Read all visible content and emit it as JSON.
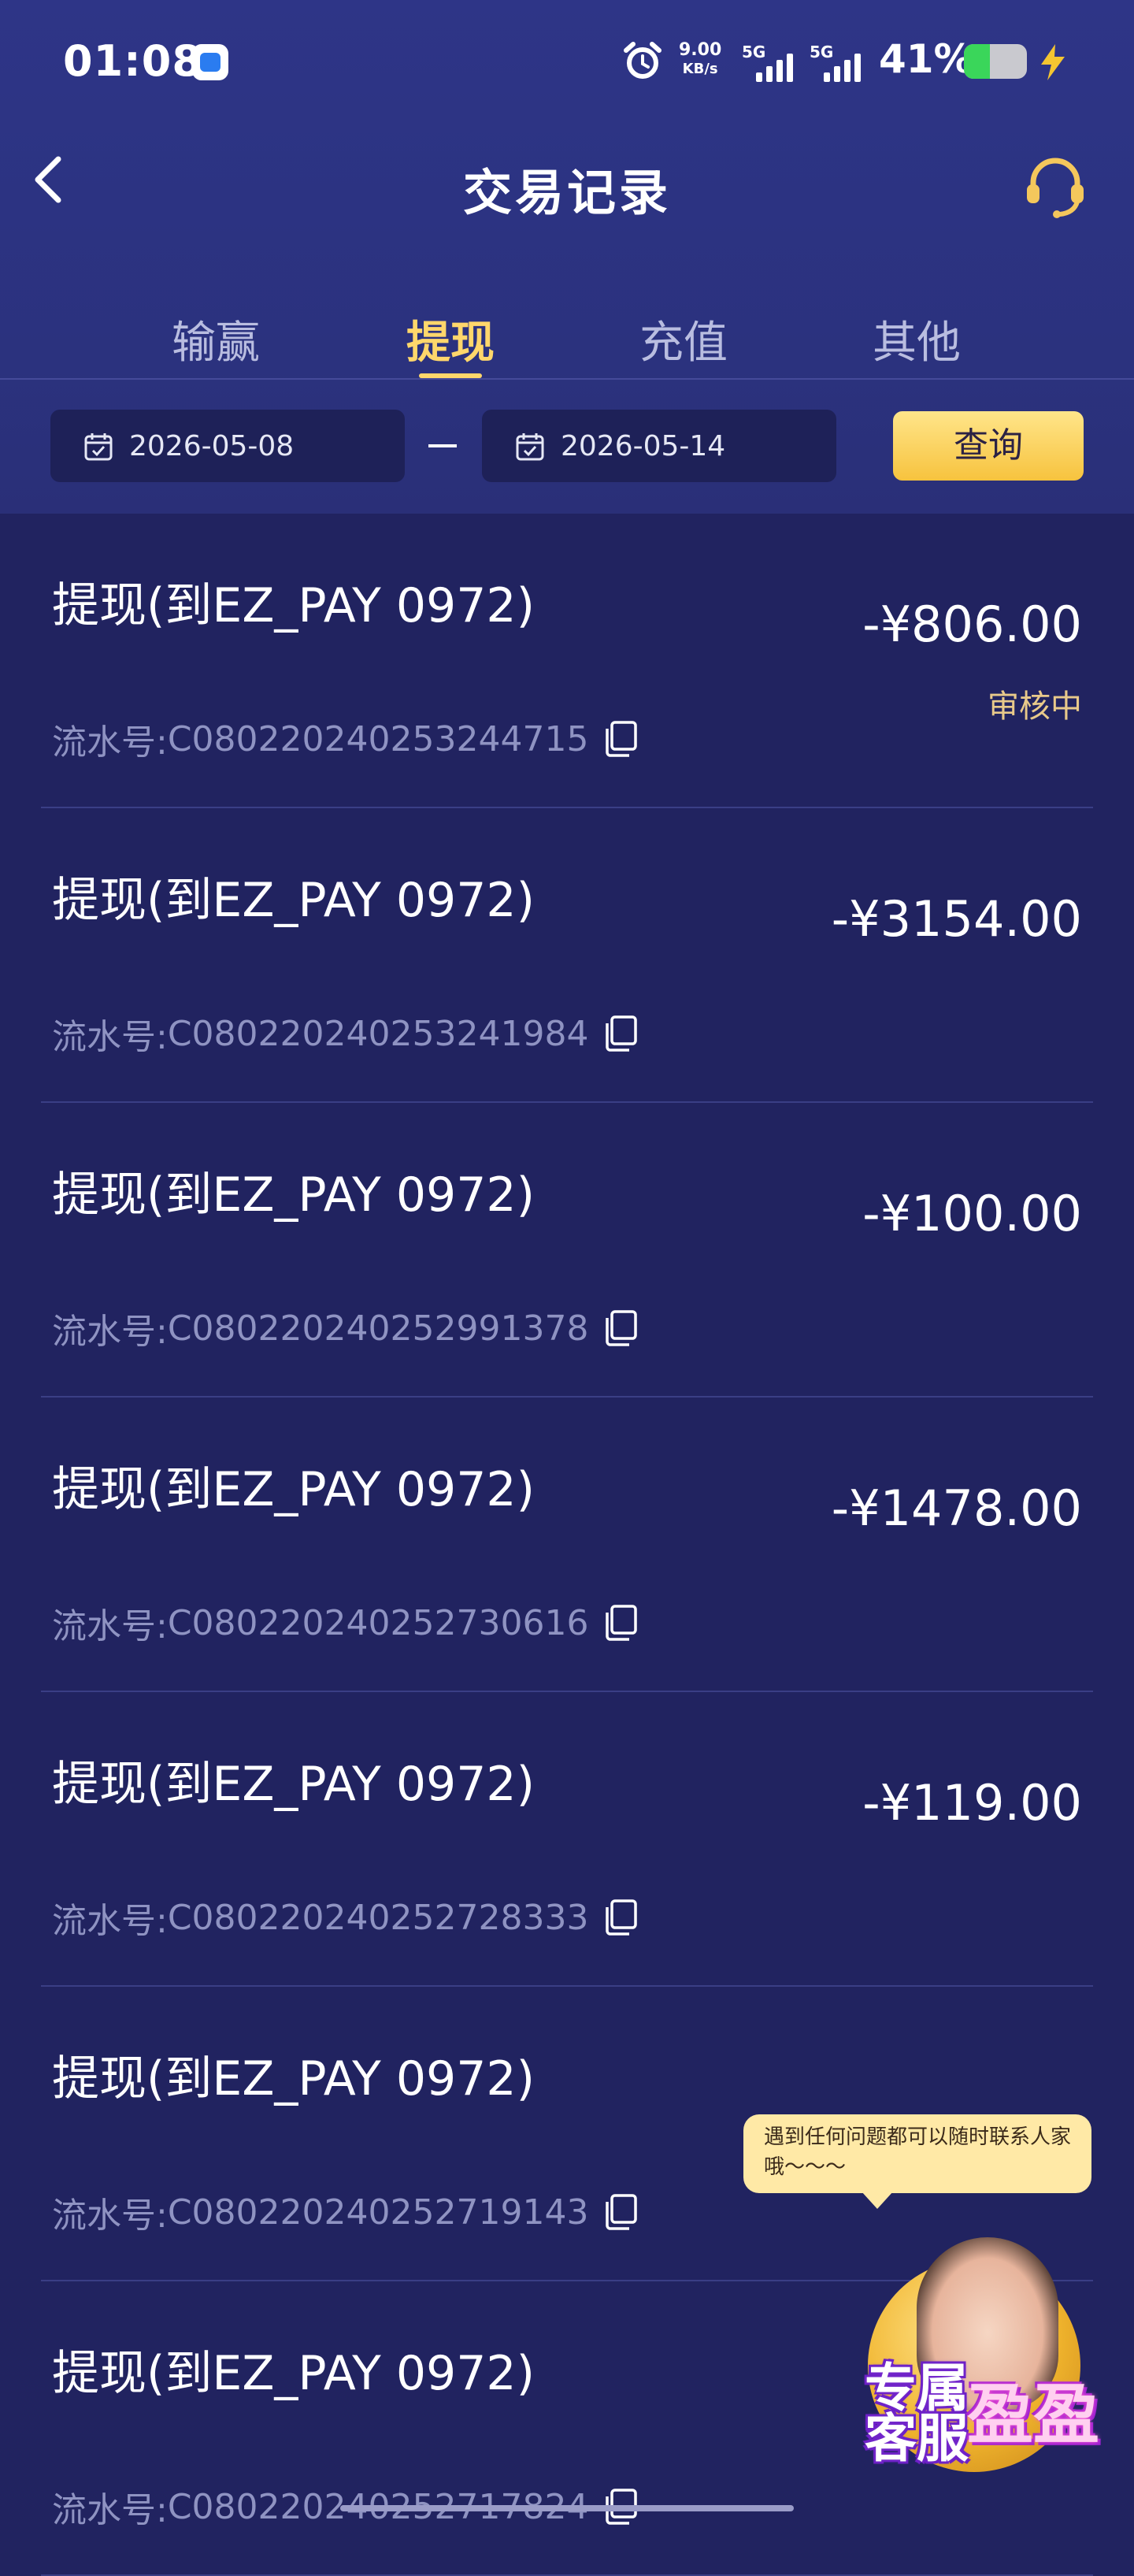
{
  "status_bar": {
    "time": "01:08",
    "net_speed_value": "9.00",
    "net_speed_unit": "KB/s",
    "signal1_label": "5G",
    "signal2_label": "5G",
    "battery_percent": "41%",
    "battery_level": 0.41,
    "battery_color": "#3ad65a"
  },
  "header": {
    "title": "交易记录",
    "back_icon": "chevron-left-icon",
    "cs_icon": "headset-icon"
  },
  "tabs": [
    {
      "label": "输赢",
      "active": false
    },
    {
      "label": "提现",
      "active": true
    },
    {
      "label": "充值",
      "active": false
    },
    {
      "label": "其他",
      "active": false
    }
  ],
  "filters": {
    "start_date": "2026-05-08",
    "end_date": "2026-05-14",
    "separator": "—",
    "query_label": "查询"
  },
  "colors": {
    "background": "#212360",
    "accent": "#ffd76b",
    "status_text": "#e8c98a"
  },
  "records": [
    {
      "title": "提现(到EZ_PAY 0972)",
      "amount": "-¥806.00",
      "status": "审核中",
      "serial_label": "流水号: ",
      "serial": "C080220240253244715"
    },
    {
      "title": "提现(到EZ_PAY 0972)",
      "amount": "-¥3154.00",
      "status": "",
      "serial_label": "流水号: ",
      "serial": "C080220240253241984"
    },
    {
      "title": "提现(到EZ_PAY 0972)",
      "amount": "-¥100.00",
      "status": "",
      "serial_label": "流水号: ",
      "serial": "C080220240252991378"
    },
    {
      "title": "提现(到EZ_PAY 0972)",
      "amount": "-¥1478.00",
      "status": "",
      "serial_label": "流水号: ",
      "serial": "C080220240252730616"
    },
    {
      "title": "提现(到EZ_PAY 0972)",
      "amount": "-¥119.00",
      "status": "",
      "serial_label": "流水号: ",
      "serial": "C080220240252728333"
    },
    {
      "title": "提现(到EZ_PAY 0972)",
      "amount": "",
      "status": "",
      "serial_label": "流水号: ",
      "serial": "C080220240252719143"
    },
    {
      "title": "提现(到EZ_PAY 0972)",
      "amount": "",
      "status": "",
      "serial_label": "流水号: ",
      "serial": "C080220240252717824"
    }
  ],
  "cs_widget": {
    "bubble_text": "遇到任何问题都可以随时联系人家哦～～～",
    "label_line1": "专属",
    "label_line2": "客服",
    "name": "盈盈"
  }
}
